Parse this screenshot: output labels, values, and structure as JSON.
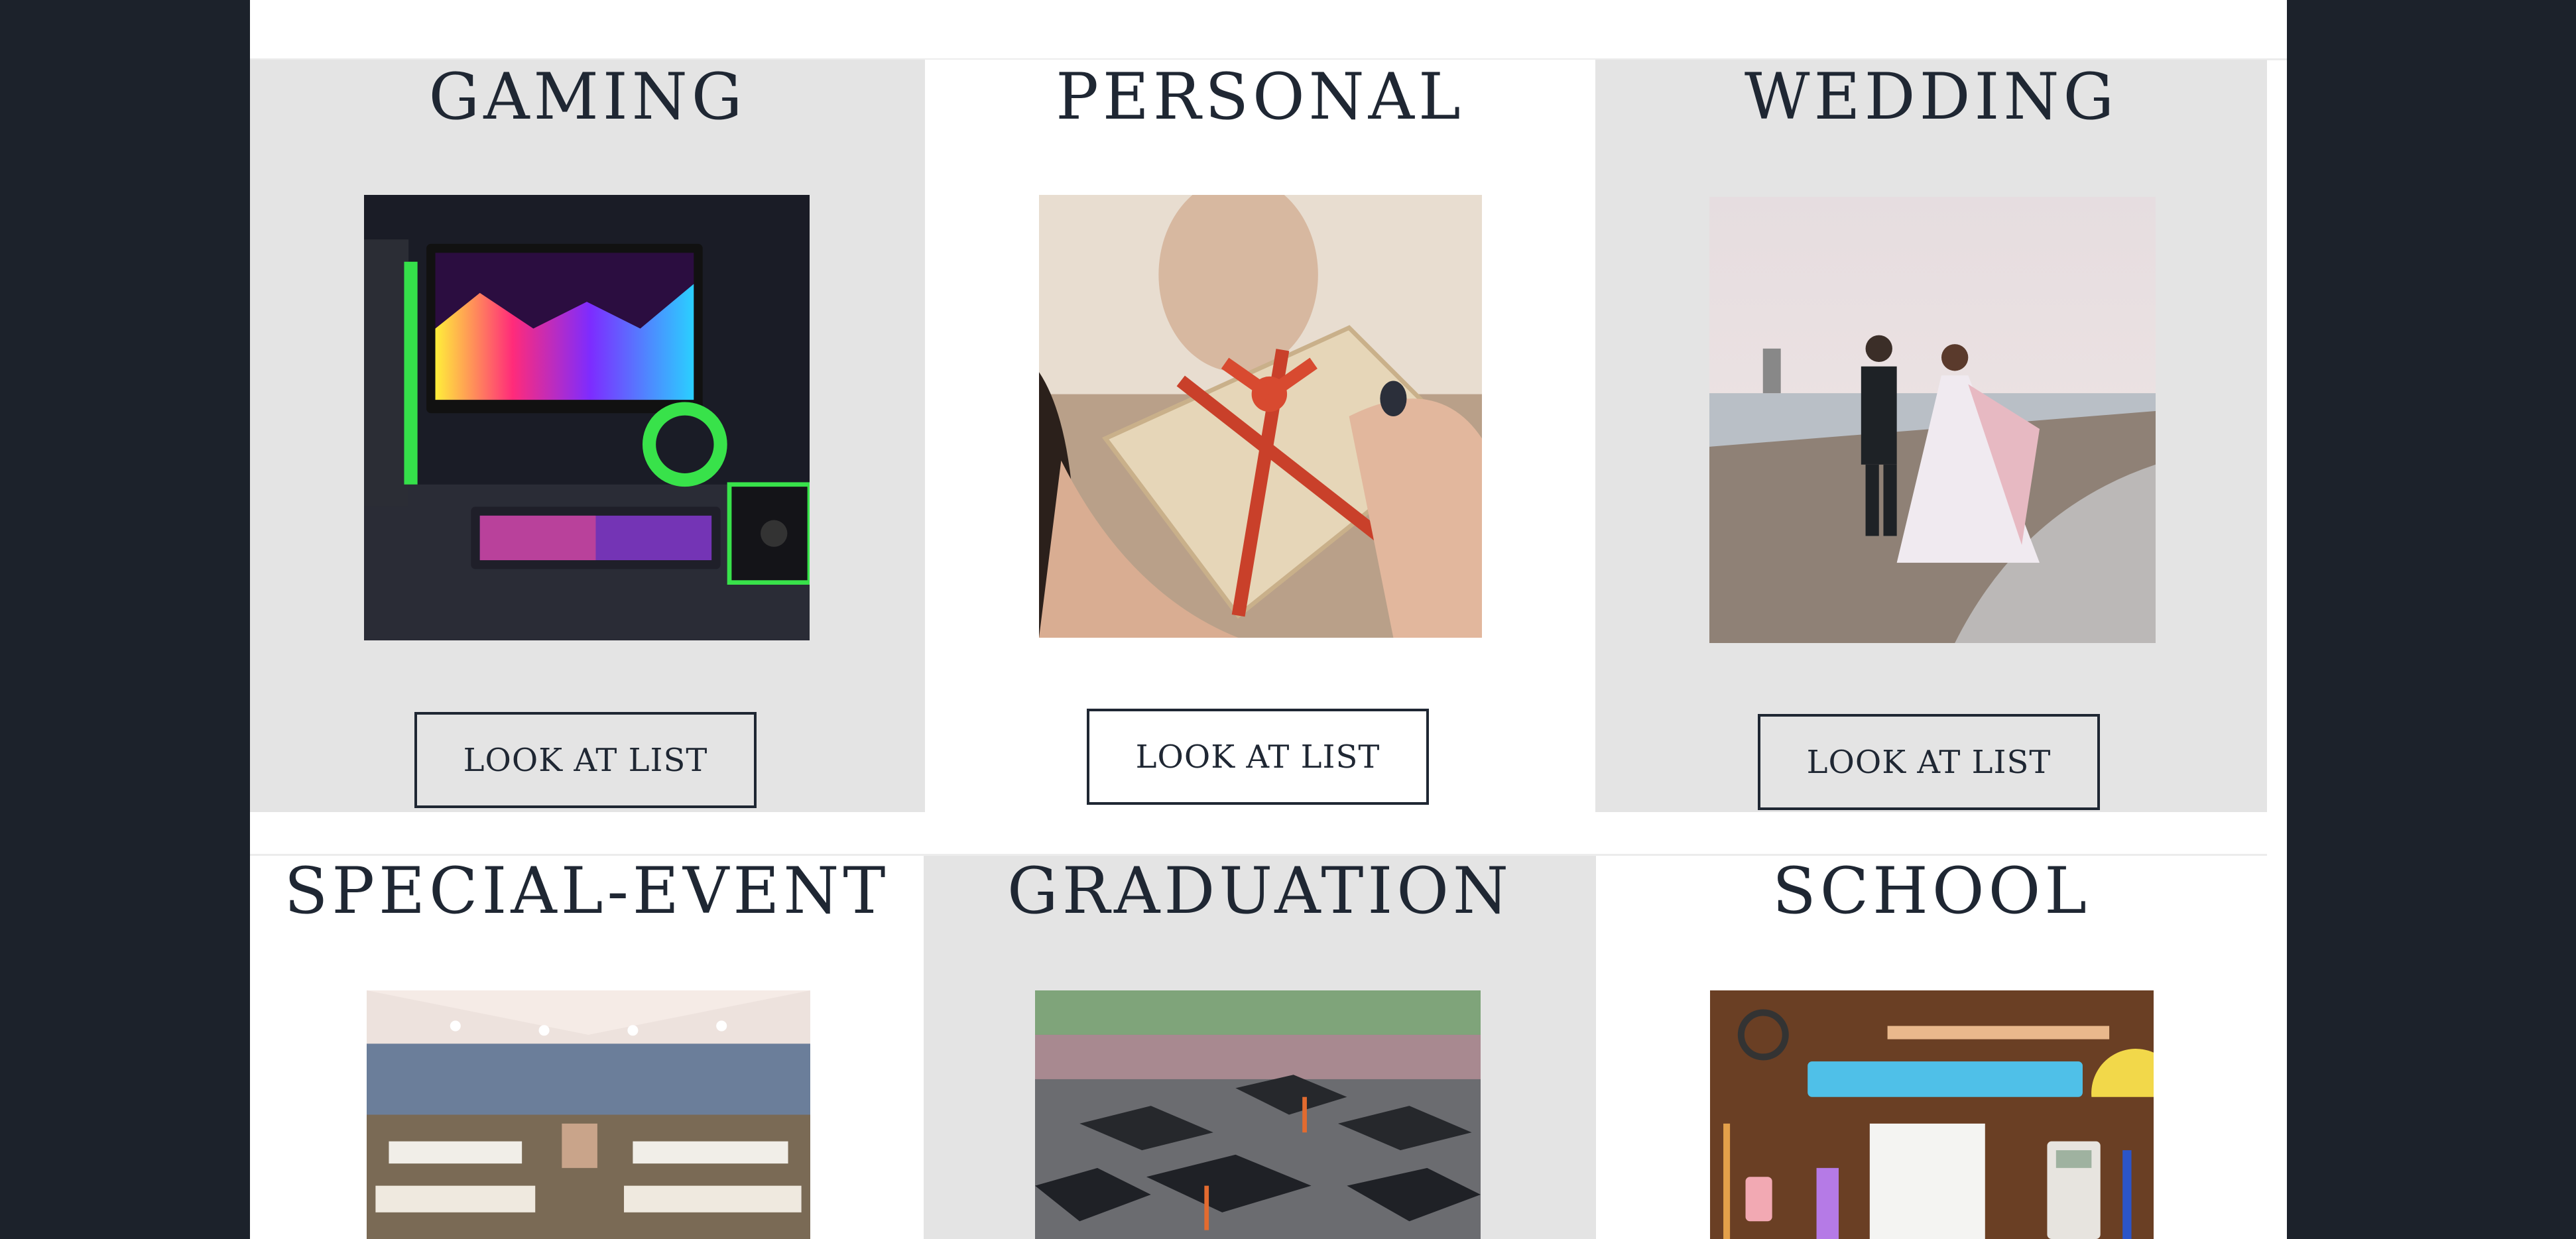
{
  "categories": [
    {
      "title": "GAMING",
      "button_label": "LOOK AT LIST",
      "image": "gaming-setup-image"
    },
    {
      "title": "PERSONAL",
      "button_label": "LOOK AT LIST",
      "image": "gift-box-image"
    },
    {
      "title": "WEDDING",
      "button_label": "LOOK AT LIST",
      "image": "beach-wedding-image"
    },
    {
      "title": "SPECIAL-EVENT",
      "button_label": "",
      "image": "event-tent-image"
    },
    {
      "title": "GRADUATION",
      "button_label": "",
      "image": "graduation-caps-image"
    },
    {
      "title": "SCHOOL",
      "button_label": "",
      "image": "school-supplies-image"
    }
  ],
  "colors": {
    "background": "#1c222b",
    "card_grey": "#e4e4e4",
    "card_white": "#ffffff",
    "text": "#1f2733"
  }
}
